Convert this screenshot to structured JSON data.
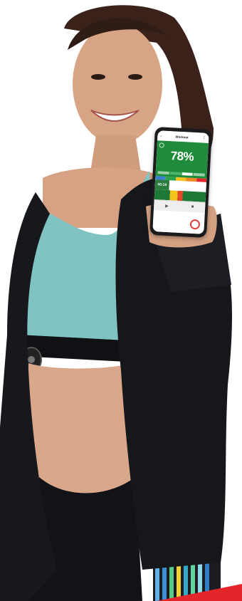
{
  "phone_screen": {
    "app_title": "Workout",
    "sensor_label": "",
    "effort_percent": "78%",
    "zone_text": "",
    "elapsed_time": "00:19",
    "track_label": "",
    "play_icon": "play-icon",
    "stop_icon": "stop-icon"
  },
  "colors": {
    "hero_green": "#1f8c3b",
    "jacket": "#15161a",
    "top": "#7cc3c4",
    "skin": "#d9a98a",
    "accent_red": "#e3262c"
  }
}
